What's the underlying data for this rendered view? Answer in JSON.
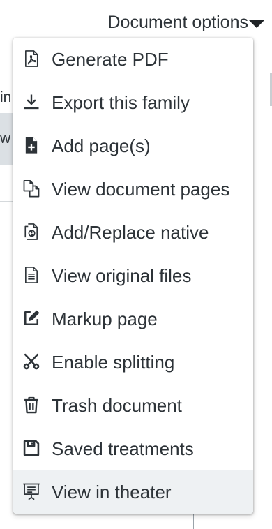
{
  "header": {
    "options_label": "Document options",
    "caret_icon": "caret-down-icon"
  },
  "background": {
    "fragment_1": "in",
    "fragment_2": "w"
  },
  "menu": {
    "items": [
      {
        "label": "Generate PDF",
        "icon": "pdf-icon"
      },
      {
        "label": "Export this family",
        "icon": "download-icon"
      },
      {
        "label": "Add page(s)",
        "icon": "file-plus-icon"
      },
      {
        "label": "View document pages",
        "icon": "documents-icon"
      },
      {
        "label": "Add/Replace native",
        "icon": "file-replace-icon"
      },
      {
        "label": "View original files",
        "icon": "file-text-icon"
      },
      {
        "label": "Markup page",
        "icon": "edit-icon"
      },
      {
        "label": "Enable splitting",
        "icon": "scissors-icon"
      },
      {
        "label": "Trash document",
        "icon": "trash-icon"
      },
      {
        "label": "Saved treatments",
        "icon": "save-icon"
      },
      {
        "label": "View in theater",
        "icon": "presentation-icon"
      }
    ],
    "active_item": "View in theater"
  },
  "colors": {
    "text": "#2d3338",
    "active_bg": "#eef1f3",
    "icon": "#2d3338"
  }
}
